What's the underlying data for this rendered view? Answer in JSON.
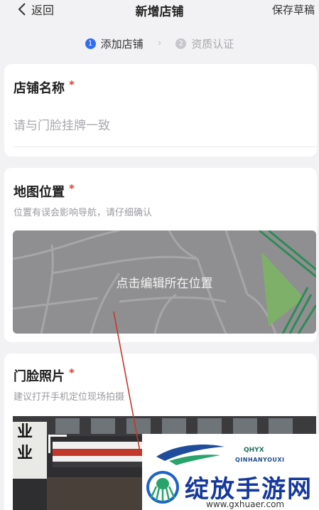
{
  "nav": {
    "back_label": "返回",
    "title": "新增店铺",
    "save_draft_label": "保存草稿"
  },
  "steps": [
    {
      "num": "1",
      "label": "添加店铺",
      "state": "active"
    },
    {
      "num": "2",
      "label": "资质认证",
      "state": "inactive"
    }
  ],
  "store_name": {
    "title": "店铺名称",
    "required_mark": "*",
    "placeholder": "请与门脸挂牌一致"
  },
  "map_location": {
    "title": "地图位置",
    "required_mark": "*",
    "hint": "位置有误会影响导航，请仔细确认",
    "map_overlay_text": "点击编辑所在位置"
  },
  "storefront_photo": {
    "title": "门脸照片",
    "required_mark": "*",
    "hint": "建议打开手机定位现场拍摄",
    "sign_text": [
      "业",
      "业"
    ]
  },
  "watermark": {
    "brand_cn": "绽放手游网",
    "brand_latin_1": "QHYX",
    "brand_latin_2": "QINHANYOUXI",
    "url": "www.gxhuaer.com"
  },
  "colors": {
    "accent": "#2f6cf6",
    "required": "#e23b2e",
    "annotation_arrow": "#c0392b",
    "map_bg": "#8f8f91",
    "map_park": "#7fb069",
    "map_road_green": "#2e8b57"
  }
}
